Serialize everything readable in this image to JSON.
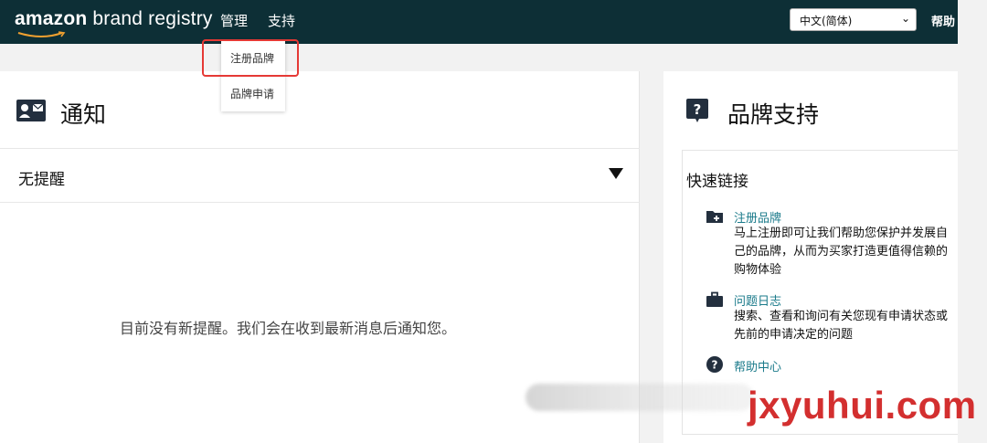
{
  "header": {
    "logo_text_bold": "amazon",
    "logo_text_rest": " brand registry",
    "nav": {
      "manage": "管理",
      "support": "支持"
    },
    "language": "中文(简体)",
    "help": "帮助"
  },
  "manage_menu": {
    "items": [
      "注册品牌",
      "品牌申请"
    ],
    "highlighted_index": 0
  },
  "notifications": {
    "title": "通知",
    "filter": "无提醒",
    "empty_message": "目前没有新提醒。我们会在收到最新消息后通知您。"
  },
  "brand_support": {
    "title": "品牌支持",
    "quick_links_title": "快速链接",
    "links": [
      {
        "icon": "folder-plus-icon",
        "title": "注册品牌",
        "description": "马上注册即可让我们帮助您保护并发展自己的品牌，从而为买家打造更值得信赖的购物体验"
      },
      {
        "icon": "briefcase-icon",
        "title": "问题日志",
        "description": "搜索、查看和询问有关您现有申请状态或先前的申请决定的问题"
      },
      {
        "icon": "question-circle-icon",
        "title": "帮助中心",
        "description": ""
      }
    ]
  },
  "watermark": "jxyuhui.com",
  "colors": {
    "topbar": "#0d2f36",
    "link": "#1a7a8a",
    "highlight": "#e53935",
    "watermark": "#d32f2f"
  }
}
